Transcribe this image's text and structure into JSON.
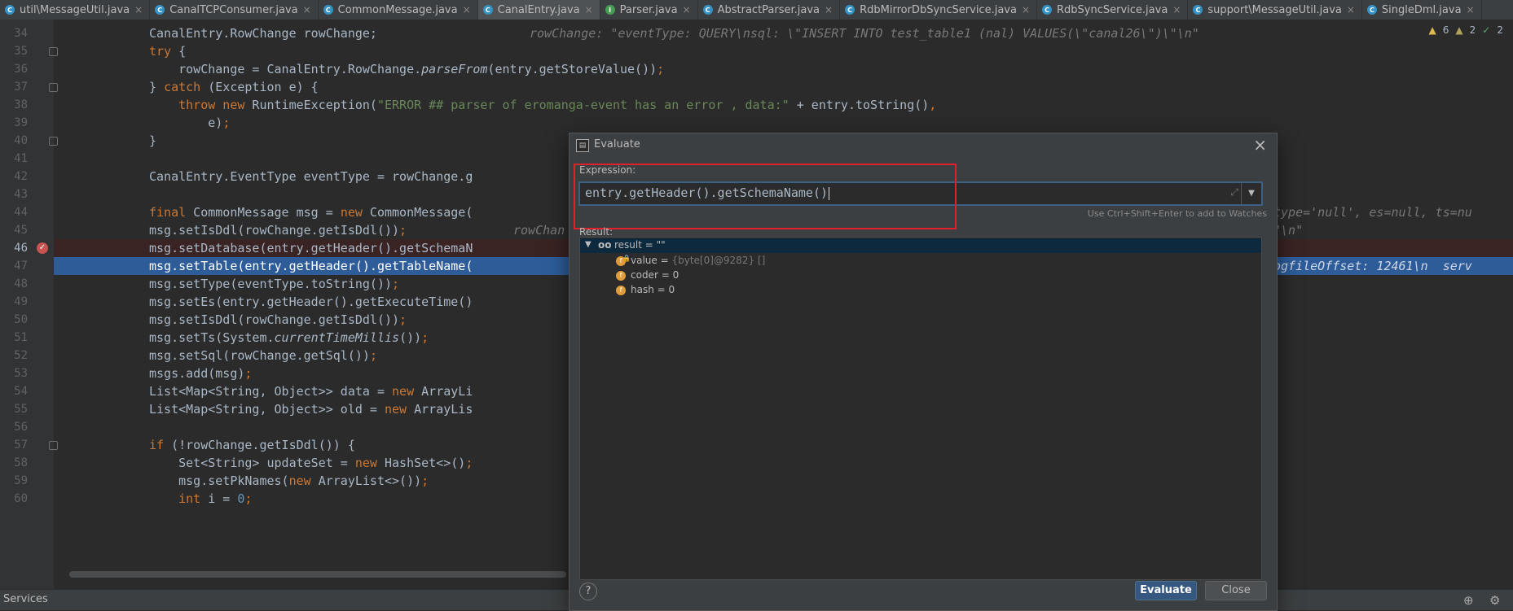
{
  "tabs": [
    {
      "label": "util\\MessageUtil.java",
      "icon": "c",
      "active": false
    },
    {
      "label": "CanalTCPConsumer.java",
      "icon": "c",
      "active": false
    },
    {
      "label": "CommonMessage.java",
      "icon": "c",
      "active": false
    },
    {
      "label": "CanalEntry.java",
      "icon": "c",
      "active": true
    },
    {
      "label": "Parser.java",
      "icon": "g",
      "active": false
    },
    {
      "label": "AbstractParser.java",
      "icon": "a",
      "active": false
    },
    {
      "label": "RdbMirrorDbSyncService.java",
      "icon": "c",
      "active": false
    },
    {
      "label": "RdbSyncService.java",
      "icon": "c",
      "active": false
    },
    {
      "label": "support\\MessageUtil.java",
      "icon": "c",
      "active": false
    },
    {
      "label": "SingleDml.java",
      "icon": "c",
      "active": false
    }
  ],
  "inspections": {
    "warnings": "6",
    "weak": "2",
    "ok": "2"
  },
  "code": {
    "line_numbers": [
      "34",
      "35",
      "36",
      "37",
      "38",
      "39",
      "40",
      "41",
      "42",
      "43",
      "44",
      "45",
      "46",
      "47",
      "48",
      "49",
      "50",
      "51",
      "52",
      "53",
      "54",
      "55",
      "56",
      "57",
      "58",
      "59",
      "60"
    ],
    "hint_34": "rowChange: \"eventType: QUERY\\nsql: \\\"INSERT INTO test_table1 (nal) VALUES(\\\"canal26\\\")\\\"\\n\"",
    "hint_44": "type='null', es=null, ts=nu",
    "hint_45_left": "rowChan",
    "hint_45_right": "\"\\n\"",
    "hint_47": "ogfileOffset: 12461\\n  serv"
  },
  "bottom": {
    "panel_title": "Services"
  },
  "dialog": {
    "title": "Evaluate",
    "expression_label": "Expression:",
    "expression_value": "entry.getHeader().getSchemaName()",
    "watch_hint": "Use Ctrl+Shift+Enter to add to Watches",
    "result_label": "Result:",
    "result_root": "result = \"\"",
    "fields": [
      {
        "name": "value",
        "eq": " = ",
        "val": "{byte[0]@9282} []"
      },
      {
        "name": "coder",
        "eq": " = ",
        "val": "0"
      },
      {
        "name": "hash",
        "eq": " = ",
        "val": "0"
      }
    ],
    "evaluate_label": "Evaluate",
    "close_label": "Close",
    "help_label": "?"
  }
}
